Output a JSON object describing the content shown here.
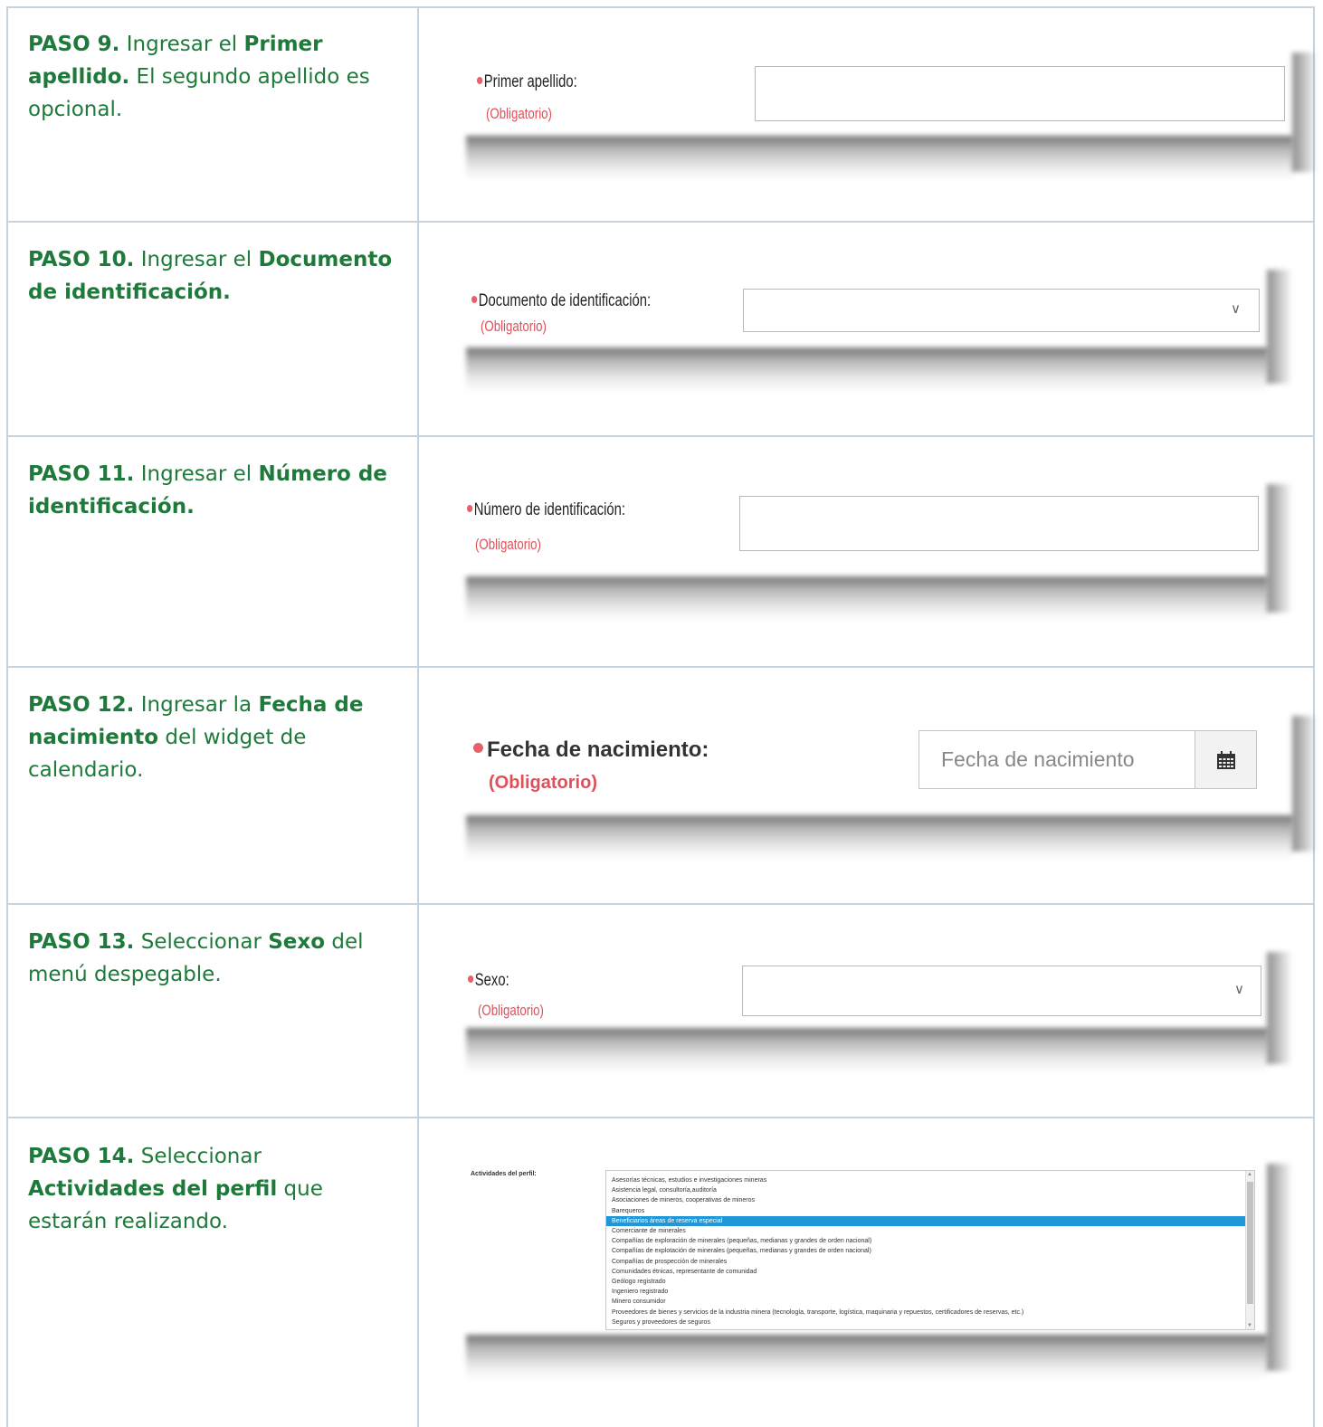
{
  "steps": [
    {
      "id": "paso9",
      "parts": [
        "PASO 9.",
        " Ingresar el ",
        "Primer apellido.",
        " El segundo apellido es opcional."
      ]
    },
    {
      "id": "paso10",
      "parts": [
        "PASO 10.",
        " Ingresar el ",
        "Documento de identificación."
      ]
    },
    {
      "id": "paso11",
      "parts": [
        "PASO 11.",
        " Ingresar el ",
        "Número de identificación."
      ]
    },
    {
      "id": "paso12",
      "parts": [
        "PASO 12.",
        " Ingresar la ",
        "Fecha de nacimiento",
        " del widget de calendario."
      ]
    },
    {
      "id": "paso13",
      "parts": [
        "PASO 13.",
        " Seleccionar ",
        "Sexo",
        " del menú despegable."
      ]
    },
    {
      "id": "paso14",
      "parts": [
        "PASO 14.",
        " Seleccionar ",
        "Actividades del perfil",
        " que estarán realizando."
      ]
    }
  ],
  "form": {
    "required_text": "(Obligatorio)",
    "primer_apellido_label": "Primer apellido:",
    "documento_label": "Documento de identificación:",
    "numero_label": "Número de identificación:",
    "fecha_label": "Fecha de nacimiento:",
    "fecha_placeholder": "Fecha de nacimiento",
    "sexo_label": "Sexo:",
    "actividades_label": "Actividades del perfil:",
    "actividades_options": [
      "Asesorías técnicas, estudios e investigaciones mineras",
      "Asistencia legal, consultoría,auditoría",
      "Asociaciones de mineros, cooperativas de mineros",
      "Barequeros",
      "Beneficiarios áreas de reserva especial",
      "Comerciante de minerales",
      "Compañías de exploración de minerales (pequeñas, medianas y grandes de orden nacional)",
      "Compañías de explotación de minerales (pequeñas, medianas y grandes de orden nacional)",
      "Compañías de prospección de minerales",
      "Comunidades étnicas, representante de comunidad",
      "Geólogo registrado",
      "Ingeniero registrado",
      "Minero consumidor",
      "Proveedores de bienes y servicios de la industria minera (tecnología, transporte, logística, maquinaria y repuestos, certificadores de reservas, etc.)",
      "Seguros y proveedores de seguros"
    ],
    "actividades_selected_index": 4
  },
  "colors": {
    "step_text": "#1e7a3a",
    "required": "#e0505a",
    "selected_bg": "#1f97d8",
    "grid": "#c6d3de"
  }
}
